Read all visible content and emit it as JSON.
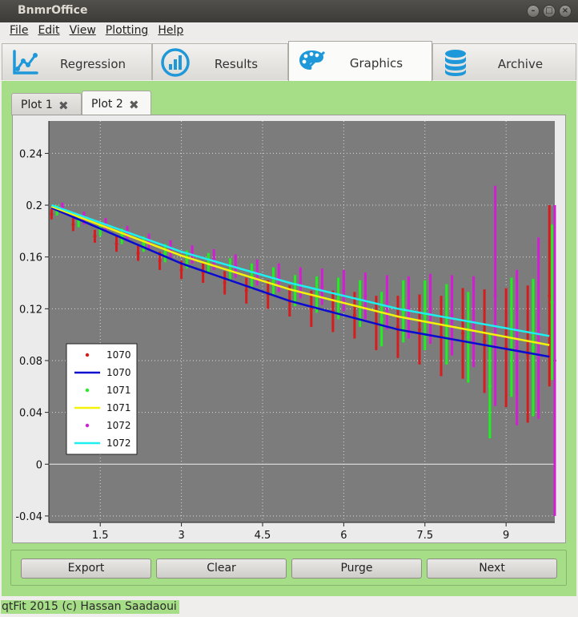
{
  "window": {
    "title": "BnmrOffice"
  },
  "menu": [
    {
      "label": "File"
    },
    {
      "label": "Edit"
    },
    {
      "label": "View"
    },
    {
      "label": "Plotting"
    },
    {
      "label": "Help"
    }
  ],
  "tabs": [
    {
      "label": "Regression",
      "icon": "regression-chart-icon"
    },
    {
      "label": "Results",
      "icon": "bar-chart-icon"
    },
    {
      "label": "Graphics",
      "icon": "palette-icon",
      "active": true
    },
    {
      "label": "Archive",
      "icon": "database-icon"
    }
  ],
  "plot_tabs": [
    {
      "label": "Plot 1",
      "active": false
    },
    {
      "label": "Plot 2",
      "active": true
    }
  ],
  "buttons": {
    "export": "Export",
    "clear": "Clear",
    "purge": "Purge",
    "next": "Next"
  },
  "status": "qtFit 2015 (c) Hassan Saadaoui",
  "colors": {
    "green_pane": "#a6dd87",
    "plot_bg": "#7c7c7c",
    "series_1070_points": "#d61c1c",
    "series_1070_fit": "#0a0ad0",
    "series_1071_points": "#22ee22",
    "series_1071_fit": "#f5f20a",
    "series_1072_points": "#d21ed2",
    "series_1072_fit": "#1ef0f0"
  },
  "chart_data": {
    "type": "scatter",
    "title": "",
    "xlabel": "",
    "ylabel": "",
    "xlim": [
      0.55,
      9.9
    ],
    "ylim": [
      -0.045,
      0.265
    ],
    "xticks": [
      "1.5",
      "3",
      "4.5",
      "6",
      "7.5",
      "9"
    ],
    "yticks": [
      "0.24",
      "0.2",
      "0.16",
      "0.12",
      "0.08",
      "0.04",
      "0",
      "-0.04"
    ],
    "grid": true,
    "legend_position": "left",
    "legend": [
      "1070",
      "1070",
      "1071",
      "1071",
      "1072",
      "1072"
    ],
    "fit_curves": [
      {
        "name": "1070",
        "x": [
          0.6,
          3,
          5,
          7,
          9.8
        ],
        "y": [
          0.198,
          0.155,
          0.126,
          0.104,
          0.083
        ]
      },
      {
        "name": "1071",
        "x": [
          0.6,
          3,
          5,
          7,
          9.8
        ],
        "y": [
          0.199,
          0.161,
          0.135,
          0.114,
          0.092
        ]
      },
      {
        "name": "1072",
        "x": [
          0.6,
          3,
          5,
          7,
          9.8
        ],
        "y": [
          0.2,
          0.164,
          0.14,
          0.12,
          0.099
        ]
      }
    ],
    "series": [
      {
        "name": "1070",
        "x": [
          0.6,
          1.0,
          1.4,
          1.8,
          2.2,
          2.6,
          3.0,
          3.4,
          3.8,
          4.2,
          4.6,
          5.0,
          5.4,
          5.8,
          6.2,
          6.6,
          7.0,
          7.4,
          7.8,
          8.2,
          8.6,
          9.0,
          9.4,
          9.8
        ],
        "y": [
          0.193,
          0.185,
          0.176,
          0.17,
          0.163,
          0.157,
          0.15,
          0.148,
          0.14,
          0.134,
          0.131,
          0.126,
          0.12,
          0.118,
          0.115,
          0.109,
          0.106,
          0.104,
          0.099,
          0.101,
          0.095,
          0.09,
          0.085,
          0.13
        ],
        "err": [
          0.004,
          0.005,
          0.005,
          0.006,
          0.006,
          0.007,
          0.007,
          0.008,
          0.009,
          0.01,
          0.011,
          0.012,
          0.014,
          0.016,
          0.018,
          0.021,
          0.024,
          0.027,
          0.031,
          0.035,
          0.04,
          0.046,
          0.053,
          0.07
        ]
      },
      {
        "name": "1071",
        "x": [
          0.7,
          1.1,
          1.5,
          1.9,
          2.3,
          2.7,
          3.1,
          3.5,
          3.9,
          4.3,
          4.7,
          5.1,
          5.5,
          5.9,
          6.3,
          6.7,
          7.1,
          7.5,
          7.9,
          8.3,
          8.7,
          9.1,
          9.5,
          9.85
        ],
        "y": [
          0.196,
          0.188,
          0.181,
          0.176,
          0.17,
          0.163,
          0.158,
          0.155,
          0.15,
          0.145,
          0.141,
          0.134,
          0.131,
          0.128,
          0.124,
          0.112,
          0.118,
          0.115,
          0.108,
          0.098,
          0.06,
          0.098,
          0.09,
          0.125
        ],
        "err": [
          0.004,
          0.005,
          0.005,
          0.006,
          0.006,
          0.007,
          0.007,
          0.008,
          0.009,
          0.01,
          0.011,
          0.012,
          0.014,
          0.016,
          0.018,
          0.021,
          0.024,
          0.027,
          0.031,
          0.035,
          0.04,
          0.046,
          0.053,
          0.06
        ]
      },
      {
        "name": "1072",
        "x": [
          0.8,
          1.2,
          1.6,
          2.0,
          2.4,
          2.8,
          3.2,
          3.6,
          4.0,
          4.4,
          4.8,
          5.2,
          5.6,
          6.0,
          6.4,
          6.8,
          7.2,
          7.6,
          8.0,
          8.4,
          8.8,
          9.2,
          9.6,
          9.9
        ],
        "y": [
          0.198,
          0.19,
          0.185,
          0.178,
          0.172,
          0.166,
          0.162,
          0.158,
          0.153,
          0.148,
          0.144,
          0.14,
          0.137,
          0.134,
          0.13,
          0.125,
          0.121,
          0.12,
          0.115,
          0.11,
          0.13,
          0.09,
          0.105,
          0.08
        ],
        "err": [
          0.004,
          0.005,
          0.005,
          0.006,
          0.006,
          0.007,
          0.007,
          0.008,
          0.009,
          0.01,
          0.011,
          0.012,
          0.014,
          0.016,
          0.018,
          0.021,
          0.024,
          0.027,
          0.031,
          0.035,
          0.085,
          0.06,
          0.07,
          0.12
        ]
      }
    ]
  }
}
